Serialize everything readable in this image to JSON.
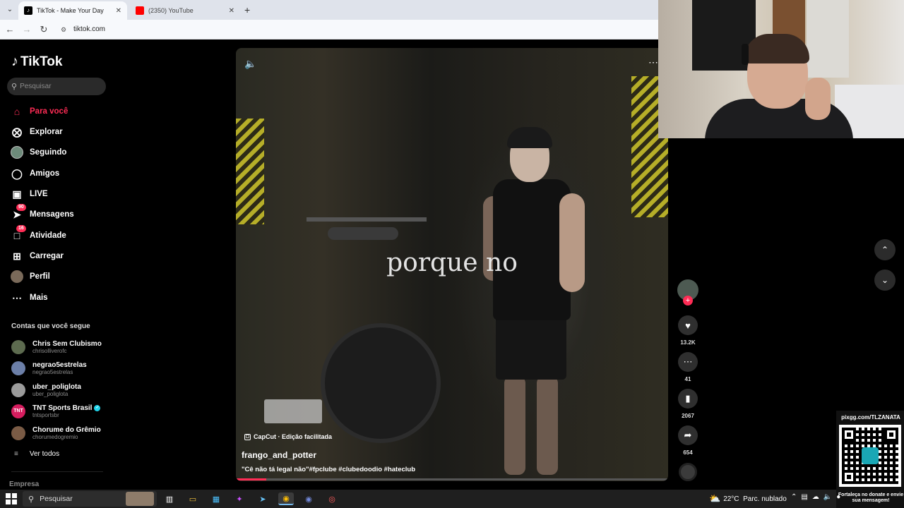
{
  "browser": {
    "tabs": [
      {
        "title": "TikTok - Make Your Day",
        "active": true,
        "favicon": "tiktok-icon"
      },
      {
        "title": "(2350) YouTube",
        "active": false,
        "favicon": "youtube-icon"
      }
    ],
    "url": "tiktok.com"
  },
  "sidebar": {
    "logo": "TikTok",
    "search_placeholder": "Pesquisar",
    "nav": [
      {
        "label": "Para você",
        "icon": "home-icon",
        "active": true
      },
      {
        "label": "Explorar",
        "icon": "compass-icon"
      },
      {
        "label": "Seguindo",
        "icon": "following-avatar-icon"
      },
      {
        "label": "Amigos",
        "icon": "friends-icon"
      },
      {
        "label": "LIVE",
        "icon": "live-icon"
      },
      {
        "label": "Mensagens",
        "icon": "messages-icon",
        "badge": "90"
      },
      {
        "label": "Atividade",
        "icon": "activity-icon",
        "badge": "16"
      },
      {
        "label": "Carregar",
        "icon": "upload-icon"
      },
      {
        "label": "Perfil",
        "icon": "profile-avatar-icon"
      },
      {
        "label": "Mais",
        "icon": "more-icon"
      }
    ],
    "following_title": "Contas que você segue",
    "accounts": [
      {
        "name": "Chris Sem Clubismo",
        "handle": "chrisolliverofc",
        "color": "#5d6b4f"
      },
      {
        "name": "negrao5estrelas",
        "handle": "negrao5estrelas",
        "color": "#6c7fa8"
      },
      {
        "name": "uber_poliglota",
        "handle": "uber_poliglota",
        "color": "#9b9b9b"
      },
      {
        "name": "TNT Sports Brasil",
        "handle": "tntsportsbr",
        "color": "#d61d5f",
        "verified": true,
        "avatar_text": "TNT"
      },
      {
        "name": "Chorume do Grêmio",
        "handle": "chorumedogremio",
        "color": "#7a5b45"
      }
    ],
    "see_all": "Ver todos",
    "footer_heading": "Empresa"
  },
  "video": {
    "overlay_text": "porque no",
    "capcut_label": "CapCut · Edição facilitada",
    "author": "frango_and_potter",
    "description": "\"Cê não tá legal não\"#fpclube #clubedoodio #hateclub",
    "progress": 0.07
  },
  "actions": {
    "likes": "13.2K",
    "comments": "41",
    "saves": "2067",
    "shares": "654"
  },
  "qr": {
    "title": "pixgg.com/TLZANATA",
    "caption": "Fortaleça no donate e envie sua mensagem!"
  },
  "taskbar": {
    "search": "Pesquisar",
    "weather_temp": "22°C",
    "weather_desc": "Parc. nublado"
  },
  "colors": {
    "accent": "#fe2c55",
    "background": "#000000"
  }
}
